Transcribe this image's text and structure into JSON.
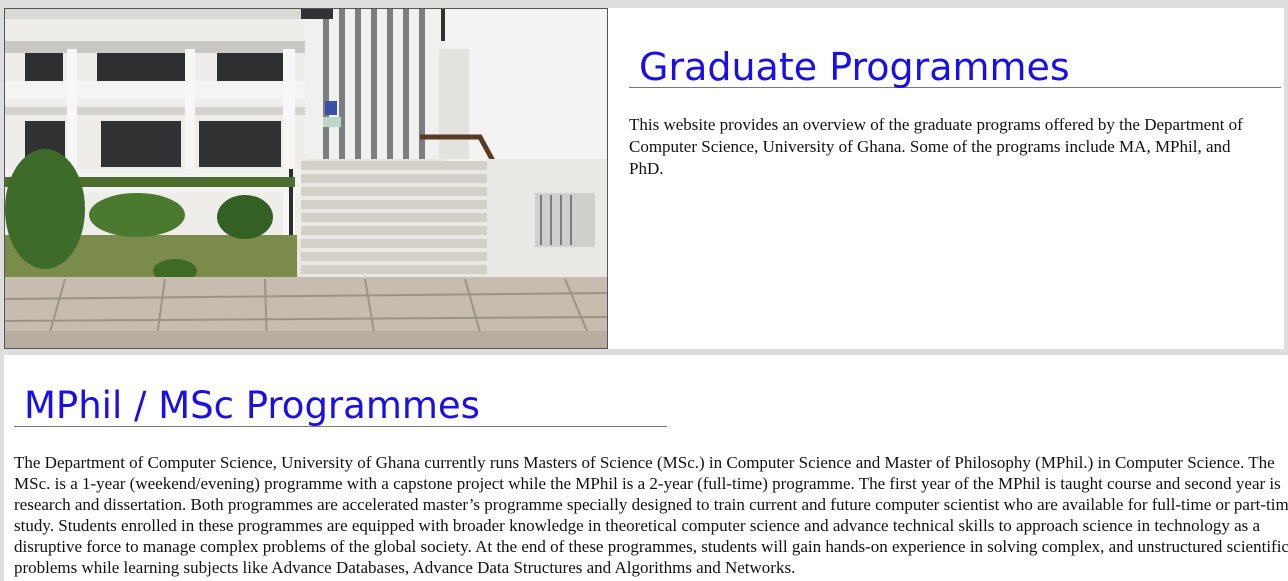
{
  "hero": {
    "photo_label": "building-stairs-photo",
    "title": "Graduate Programmes",
    "description": "This website provides an overview of the graduate programs offered by the Department of Computer Science, University of Ghana. Some of the programs include MA, MPhil, and PhD."
  },
  "mphil_section": {
    "title": "MPhil / MSc Programmes",
    "body": "The Department of Computer Science, University of Ghana currently runs Masters of Science (MSc.) in Computer Science and Master of Philosophy (MPhil.) in Computer Science. The MSc. is a 1-year (weekend/evening) programme with a capstone project while the MPhil is a 2-year (full-time) programme. The first year of the MPhil is taught course and second year is research and dissertation. Both programmes are accelerated master’s programme specially designed to train current and future computer scientist who are available for full-time or part-time study. Students enrolled in these programmes are equipped with broader knowledge in theoretical computer science and advance technical skills to approach science in technology as a disruptive force to manage complex problems of the global society. At the end of these programmes, students will gain hands-on experience in solving complex, and unstructured scientific problems while learning subjects like Advance Databases, Advance Data Structures and Algorithms and Networks."
  }
}
